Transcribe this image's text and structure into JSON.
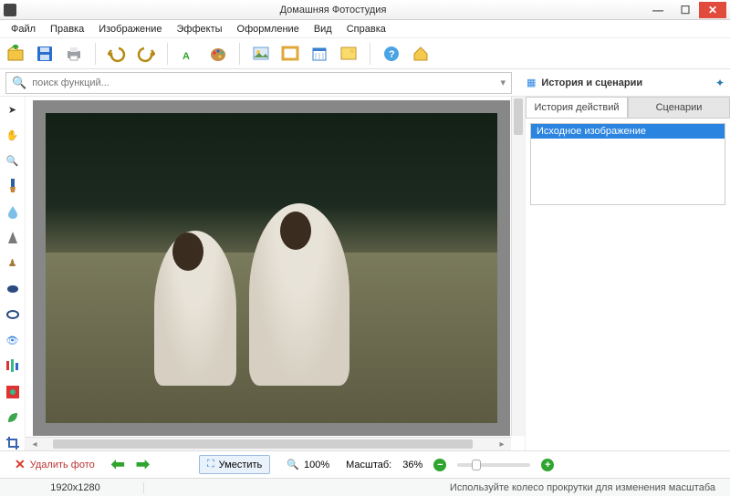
{
  "window": {
    "title": "Домашняя Фотостудия"
  },
  "menu": {
    "file": "Файл",
    "edit": "Правка",
    "image": "Изображение",
    "effects": "Эффекты",
    "design": "Оформление",
    "view": "Вид",
    "help": "Справка"
  },
  "search": {
    "placeholder": "поиск функций..."
  },
  "history_panel": {
    "title": "История и сценарии",
    "tab_history": "История действий",
    "tab_scenarios": "Сценарии"
  },
  "history_items": [
    "Исходное изображение"
  ],
  "bottom": {
    "delete": "Удалить фото",
    "fit": "Уместить",
    "zoom100": "100%",
    "scale_label": "Масштаб:",
    "scale_value": "36%"
  },
  "status": {
    "dimensions": "1920x1280",
    "hint": "Используйте колесо прокрутки для изменения масштаба"
  },
  "colors": {
    "accent": "#2a84e0",
    "green": "#2fa52f",
    "red": "#d63a2a"
  }
}
